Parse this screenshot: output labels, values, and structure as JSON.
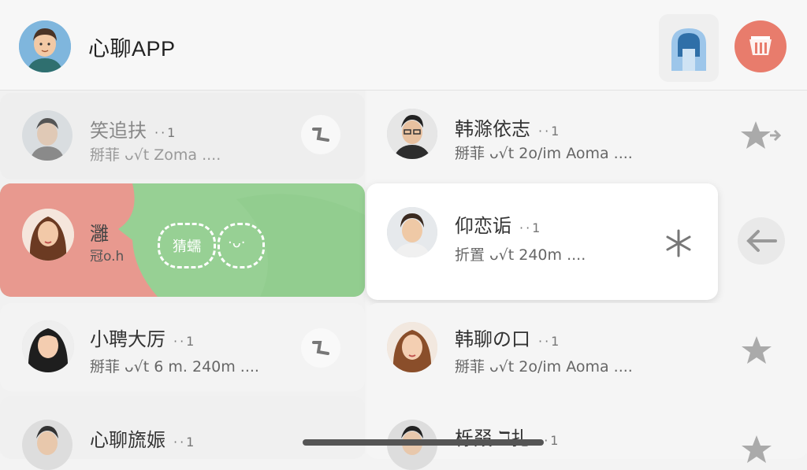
{
  "app": {
    "title": "心聊APP"
  },
  "header": {
    "ghost_icon": "ghost-icon",
    "action_icon": "box-icon"
  },
  "swipe_actions": {
    "label_1": "猜蠕",
    "label_2": "·ᴗ·"
  },
  "chats": [
    {
      "name": "笑追扶",
      "dots": "··1",
      "preview": "掰菲 ᴗ√t Zoma ....",
      "action_icon": "pin-icon"
    },
    {
      "name": "韩滁依志",
      "dots": "··1",
      "preview": "掰菲 ᴗ√t 2o/im Aoma ....",
      "action_icon": "star-icon"
    },
    {
      "name": "灉",
      "dots": "",
      "preview": "冠o.h",
      "action_icon": ""
    },
    {
      "name": "仰恋诟",
      "dots": "··1",
      "preview": "折置 ᴗ√t 240m ....",
      "action_icon": "star-icon"
    },
    {
      "name": "小聘大厉",
      "dots": "··1",
      "preview": "掰菲 ᴗ√t 6 m. 240m ....",
      "action_icon": "pin-icon"
    },
    {
      "name": "韩聊の口",
      "dots": "··1",
      "preview": "掰菲 ᴗ√t 2o/im Aoma ....",
      "action_icon": "star-icon"
    },
    {
      "name": "心聊旒娠",
      "dots": "··1",
      "preview": "",
      "action_icon": "pin-icon"
    },
    {
      "name": "栎叕 ℸ扎",
      "dots": "··1",
      "preview": "",
      "action_icon": "star-icon"
    }
  ],
  "colors": {
    "swipe_red": "#e8998f",
    "swipe_green": "#97d094",
    "accent_red": "#e87c6c",
    "ghost_blue": "#9dc6ea"
  }
}
